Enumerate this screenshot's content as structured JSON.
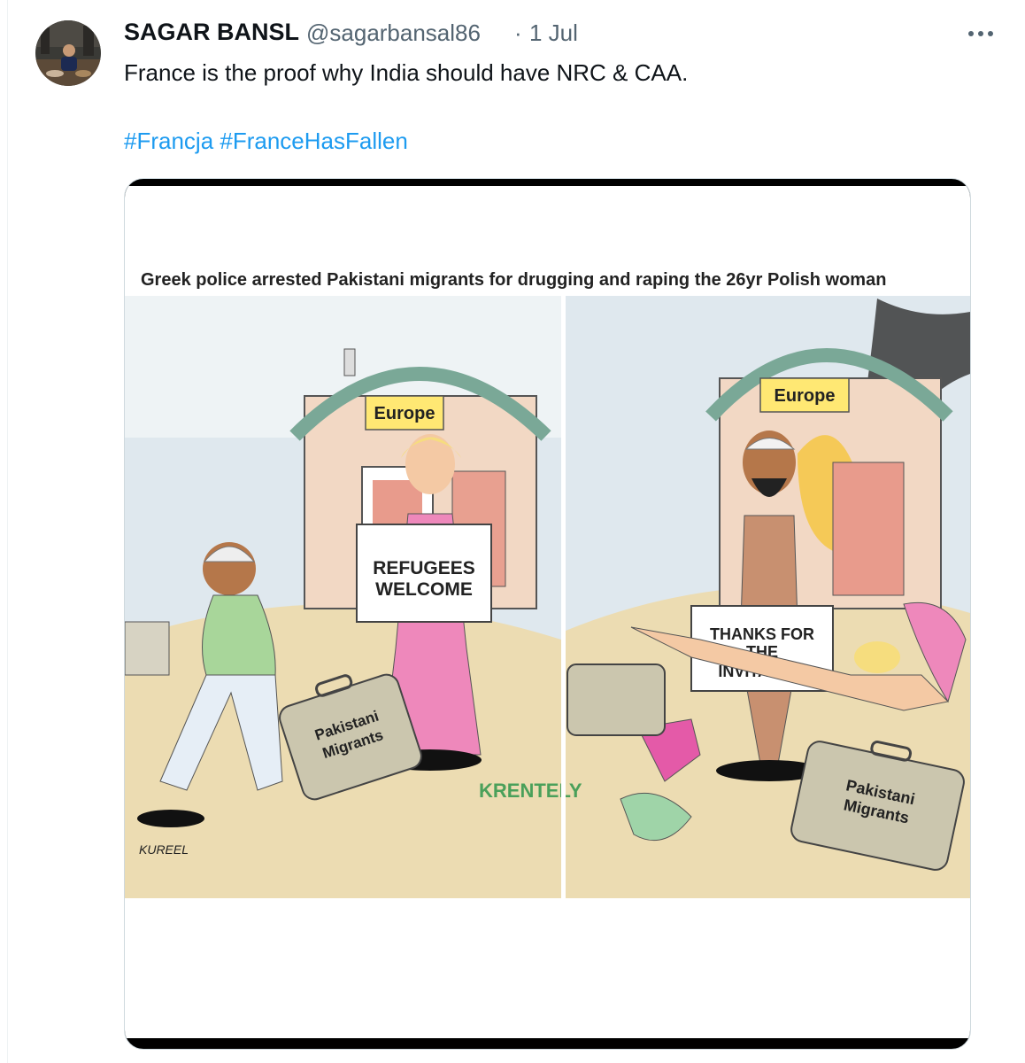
{
  "tweet": {
    "author_name": "SAGAR BANSL",
    "author_handle": "@sagarbansal86",
    "separator": "·",
    "date": "1 Jul",
    "text": "France is the proof why India should have NRC & CAA.",
    "hashtags": [
      "#Francja",
      "#FranceHasFallen"
    ]
  },
  "icons": {
    "more": "more-horizontal-icon",
    "avatar": "profile-photo"
  },
  "image": {
    "caption": "Greek police arrested Pakistani migrants for drugging and raping the 26yr Polish woman",
    "left_panel": {
      "barn_label": "Europe",
      "sign_line1": "REFUGEES",
      "sign_line2": "WELCOME",
      "suitcase_line1": "Pakistani",
      "suitcase_line2": "Migrants",
      "signature": "KUREEL"
    },
    "right_panel": {
      "barn_label": "Europe",
      "sign_line1": "THANKS FOR",
      "sign_line2": "THE",
      "sign_line3": "INVITATION",
      "suitcase_line1": "Pakistani",
      "suitcase_line2": "Migrants"
    },
    "watermark": "KRENTELY"
  },
  "colors": {
    "link": "#1d9bf0",
    "secondary_text": "#536471",
    "border": "#cfd9de"
  }
}
